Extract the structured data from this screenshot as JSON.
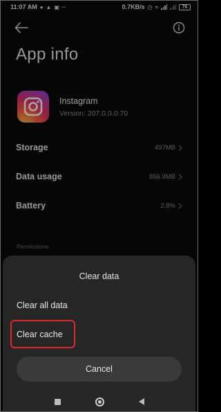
{
  "status_bar": {
    "time": "11:07 AM",
    "network_speed": "0.7KB/s",
    "battery": "76",
    "left_icons": [
      "whatsapp-icon",
      "snapchat-icon",
      "instagram-icon",
      "more-dots-icon"
    ],
    "right_icons": [
      "alarm-icon",
      "wifi-icon",
      "signal-icon",
      "signal-icon",
      "battery-icon"
    ]
  },
  "header": {
    "title": "App info"
  },
  "app": {
    "name": "Instagram",
    "version": "Version: 207.0.0.0.70",
    "icon": "instagram-icon"
  },
  "rows": [
    {
      "label": "Storage",
      "value": "497MB"
    },
    {
      "label": "Data usage",
      "value": "856.9MB"
    },
    {
      "label": "Battery",
      "value": "2.8%"
    }
  ],
  "permissions_label": "Permissions",
  "dialog": {
    "title": "Clear data",
    "options": [
      {
        "label": "Clear all data"
      },
      {
        "label": "Clear cache",
        "highlighted": true
      }
    ],
    "cancel_label": "Cancel",
    "highlight_color": "#e0272b"
  },
  "nav": [
    "recents-icon",
    "home-icon",
    "back-icon"
  ]
}
